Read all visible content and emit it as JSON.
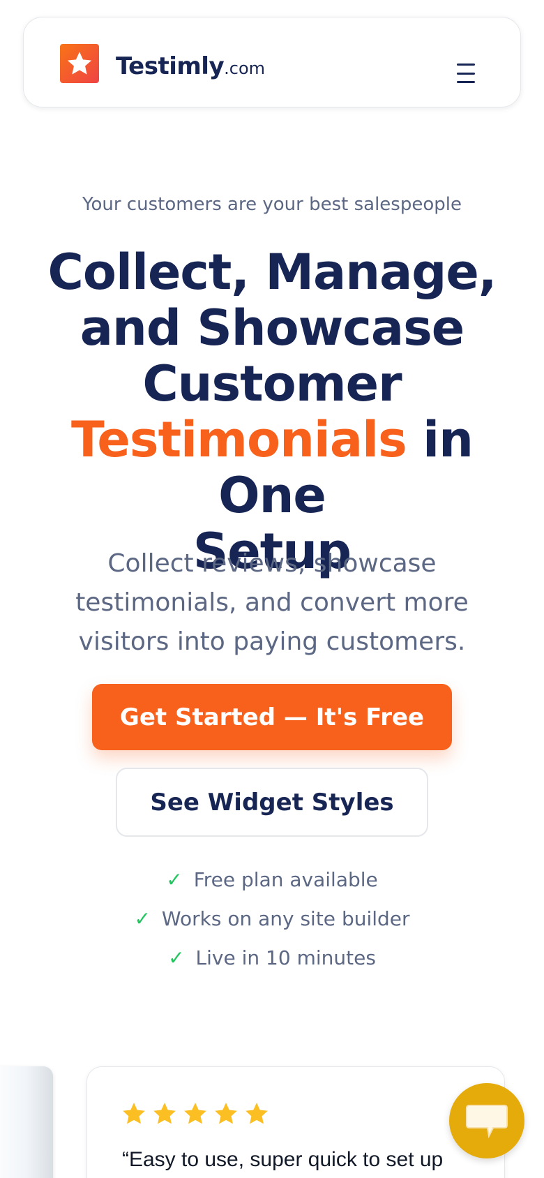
{
  "navbar": {
    "logo_name": "Testimly",
    "logo_tld": ".com",
    "logo_icon": "star-icon",
    "menu_icon": "hamburger-menu-icon"
  },
  "hero": {
    "eyebrow": "Your customers are your best salespeople",
    "headline_line1": "Collect, Manage,",
    "headline_line2": "and Showcase",
    "headline_line3": "Customer",
    "headline_accent": "Testimonials",
    "headline_after_accent": " in One",
    "headline_line5": "Setup",
    "subheadline": "Collect reviews, showcase testimonials, and convert more visitors into paying customers.",
    "primary_cta": "Get Started — It's Free",
    "secondary_cta": "See Widget Styles",
    "features": [
      "Free plan available",
      "Works on any site builder",
      "Live in 10 minutes"
    ]
  },
  "review": {
    "rating": 5,
    "quote": "“Easy to use, super quick to set up"
  },
  "chat": {
    "icon": "chat-bubble-icon"
  },
  "colors": {
    "brand_navy": "#172554",
    "accent_orange": "#f7611b",
    "muted_text": "#5b6783",
    "check_green": "#22c55e",
    "star_gold": "#fbbf24",
    "chat_gold": "#e5ab0b"
  }
}
